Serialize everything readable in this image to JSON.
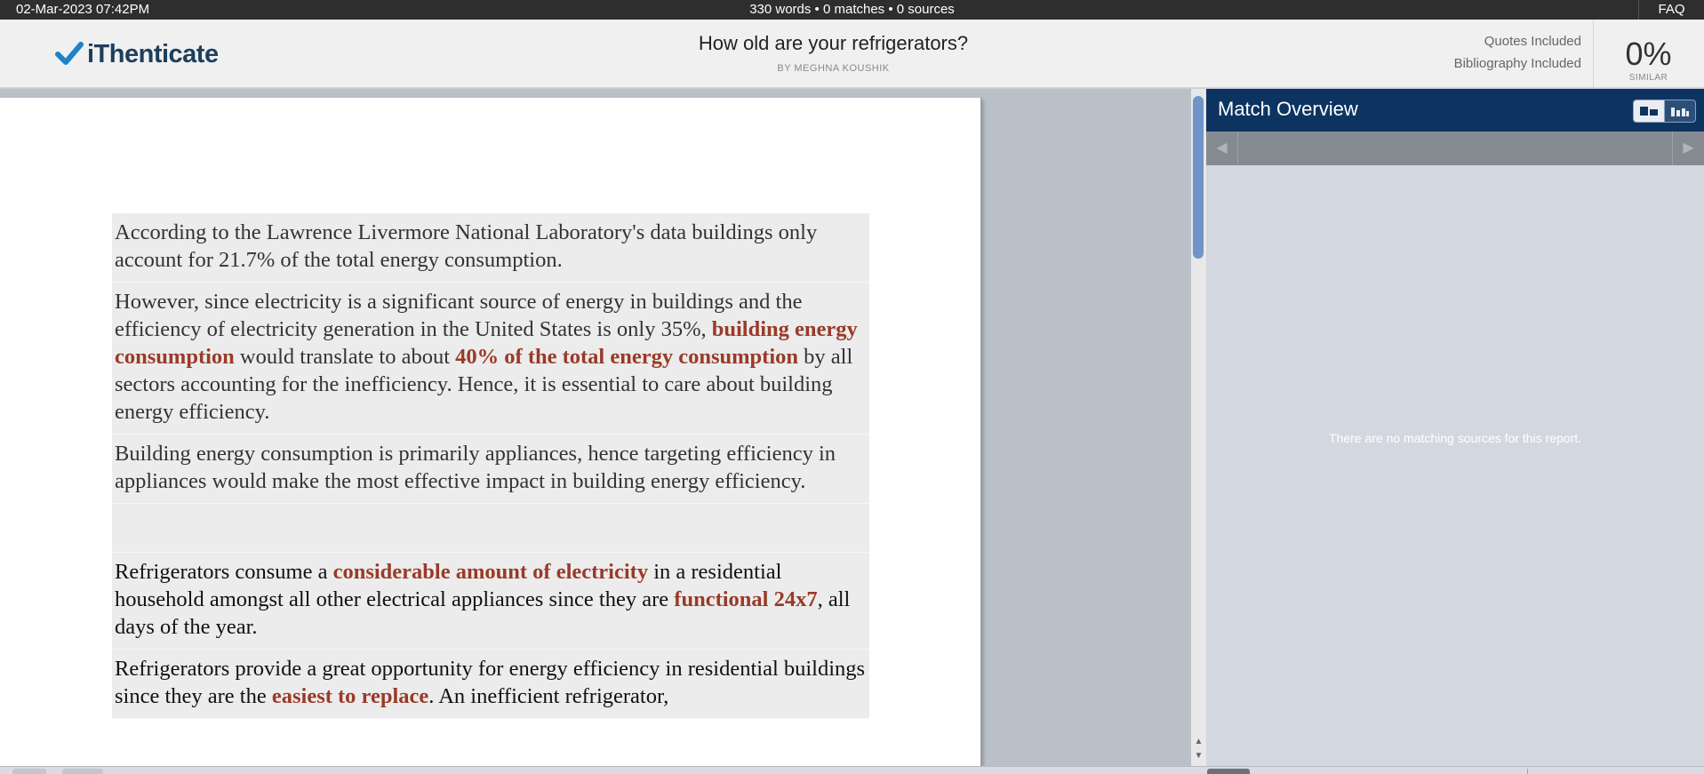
{
  "topbar": {
    "datetime": "02-Mar-2023 07:42PM",
    "stats": "330 words • 0 matches • 0 sources",
    "faq": "FAQ"
  },
  "header": {
    "logo_text": "iThenticate",
    "title": "How old are your refrigerators?",
    "author": "BY MEGHNA KOUSHIK",
    "quotes": "Quotes Included",
    "bibliography": "Bibliography Included",
    "similarity_pct": "0%",
    "similarity_label": "SIMILAR"
  },
  "document": {
    "p1": "According to the Lawrence Livermore National Laboratory's data buildings only account for 21.7% of the total energy consumption.",
    "p2": {
      "t1": "However, since electricity is a significant source of energy in buildings and the efficiency of electricity generation in the United States is only 35%, ",
      "h1": "building energy consumption",
      "t2": " would translate to about ",
      "h2": "40% of the total energy consumption",
      "t3": " by all sectors accounting for the inefficiency. Hence, it is essential to care about building energy efficiency."
    },
    "p3": "Building energy consumption is primarily appliances, hence targeting efficiency in appliances would make the most effective impact in building energy efficiency.",
    "p4": {
      "t1": "Refrigerators consume a ",
      "h1": "considerable amount of electricity",
      "t2": " in a residential household amongst all other electrical appliances since they are ",
      "h2": "functional 24x7",
      "t3": ", all days of the year."
    },
    "p5": {
      "t1": "Refrigerators provide a great opportunity for energy efficiency in residential buildings since they are the ",
      "h1": "easiest to replace",
      "t2": ". An inefficient refrigerator,"
    }
  },
  "panel": {
    "title": "Match Overview",
    "empty_message": "There are no matching sources for this report."
  },
  "colors": {
    "highlight": "#9a3a28",
    "panel_header": "#0d3461",
    "scroll_thumb": "#6e94c8"
  }
}
